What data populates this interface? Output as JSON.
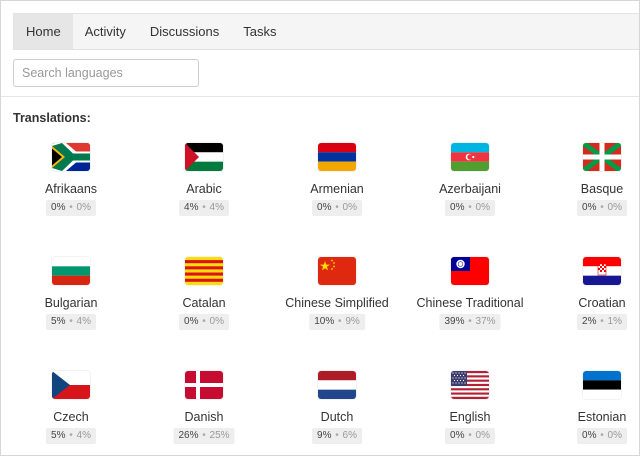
{
  "tabs": [
    {
      "label": "Home",
      "active": true
    },
    {
      "label": "Activity",
      "active": false
    },
    {
      "label": "Discussions",
      "active": false
    },
    {
      "label": "Tasks",
      "active": false
    }
  ],
  "search": {
    "placeholder": "Search languages",
    "value": ""
  },
  "section_title": "Translations:",
  "separator": "•",
  "languages": [
    {
      "name": "Afrikaans",
      "primary": "0%",
      "secondary": "0%",
      "flag": "south-africa-flag"
    },
    {
      "name": "Arabic",
      "primary": "4%",
      "secondary": "4%",
      "flag": "arab-flag"
    },
    {
      "name": "Armenian",
      "primary": "0%",
      "secondary": "0%",
      "flag": "armenia-flag"
    },
    {
      "name": "Azerbaijani",
      "primary": "0%",
      "secondary": "0%",
      "flag": "azerbaijan-flag"
    },
    {
      "name": "Basque",
      "primary": "0%",
      "secondary": "0%",
      "flag": "basque-flag"
    },
    {
      "name": "Bulgarian",
      "primary": "5%",
      "secondary": "4%",
      "flag": "bulgaria-flag"
    },
    {
      "name": "Catalan",
      "primary": "0%",
      "secondary": "0%",
      "flag": "catalonia-flag"
    },
    {
      "name": "Chinese Simplified",
      "primary": "10%",
      "secondary": "9%",
      "flag": "china-flag"
    },
    {
      "name": "Chinese Traditional",
      "primary": "39%",
      "secondary": "37%",
      "flag": "taiwan-flag"
    },
    {
      "name": "Croatian",
      "primary": "2%",
      "secondary": "1%",
      "flag": "croatia-flag"
    },
    {
      "name": "Czech",
      "primary": "5%",
      "secondary": "4%",
      "flag": "czech-flag"
    },
    {
      "name": "Danish",
      "primary": "26%",
      "secondary": "25%",
      "flag": "denmark-flag"
    },
    {
      "name": "Dutch",
      "primary": "9%",
      "secondary": "6%",
      "flag": "netherlands-flag"
    },
    {
      "name": "English",
      "primary": "0%",
      "secondary": "0%",
      "flag": "usa-flag"
    },
    {
      "name": "Estonian",
      "primary": "0%",
      "secondary": "0%",
      "flag": "estonia-flag"
    }
  ]
}
